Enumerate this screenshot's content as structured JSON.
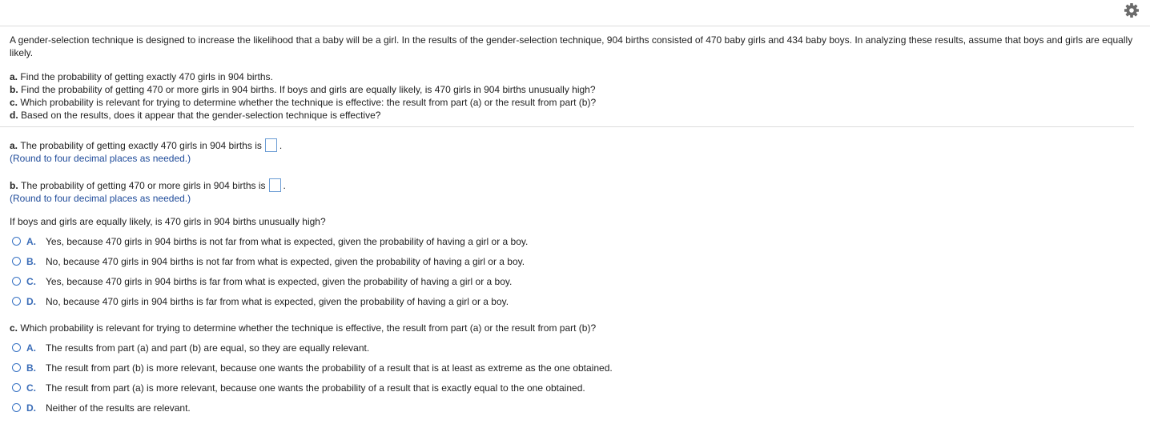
{
  "settings_icon": "gear-icon",
  "accent_color": "#3a74c4",
  "intro": "A gender-selection technique is designed to increase the likelihood that a baby will be a girl. In the results of the gender-selection technique, 904 births consisted of 470 baby girls and 434 baby boys. In analyzing these results, assume that boys and girls are equally likely.",
  "questions": [
    {
      "label": "a.",
      "text": "Find the probability of getting exactly 470 girls in 904 births."
    },
    {
      "label": "b.",
      "text": "Find the probability of getting 470 or more girls in 904 births. If boys and girls are equally likely, is 470 girls in 904 births unusually high?"
    },
    {
      "label": "c.",
      "text": "Which probability is relevant for trying to determine whether the technique is effective: the result from part (a) or the result from part (b)?"
    },
    {
      "label": "d.",
      "text": "Based on the results, does it appear that the gender-selection technique is effective?"
    }
  ],
  "part_a": {
    "label": "a.",
    "text": "The probability of getting exactly 470 girls in 904 births is",
    "end": ".",
    "hint": "(Round to four decimal places as needed.)"
  },
  "part_b": {
    "label": "b.",
    "text": "The probability of getting 470 or more girls in 904 births is",
    "end": ".",
    "hint": "(Round to four decimal places as needed.)"
  },
  "q_high": {
    "text": "If boys and girls are equally likely, is 470 girls in 904 births unusually high?",
    "options": [
      {
        "letter": "A.",
        "text": "Yes, because 470 girls in 904 births is not far from what is expected, given the probability of having a girl or a boy."
      },
      {
        "letter": "B.",
        "text": "No, because 470 girls in 904 births is not far from what is expected, given the probability of having a girl or a boy."
      },
      {
        "letter": "C.",
        "text": "Yes, because 470 girls in 904 births is far from what is expected, given the probability of having a girl or a boy."
      },
      {
        "letter": "D.",
        "text": "No, because 470 girls in 904 births is far from what is expected, given the probability of having a girl or a boy."
      }
    ]
  },
  "part_c": {
    "label": "c.",
    "text": "Which probability is relevant for trying to determine whether the technique is effective, the result from part (a) or the result from part (b)?",
    "options": [
      {
        "letter": "A.",
        "text": "The results from part (a) and part (b) are equal, so they are equally relevant."
      },
      {
        "letter": "B.",
        "text": "The result from part (b) is more relevant, because one wants the probability of a result that is at least as extreme as the one obtained."
      },
      {
        "letter": "C.",
        "text": "The result from part (a) is more relevant, because one wants the probability of a result that is exactly equal to the one obtained."
      },
      {
        "letter": "D.",
        "text": "Neither of the results are relevant."
      }
    ]
  }
}
